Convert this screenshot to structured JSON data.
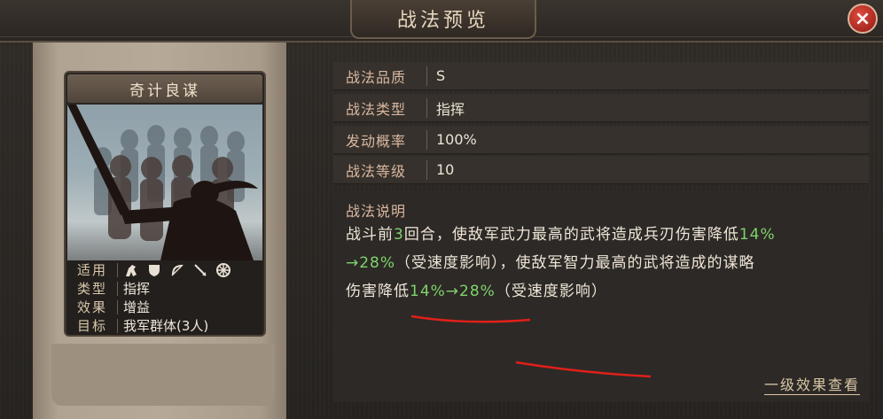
{
  "window": {
    "title": "战法预览",
    "close_symbol": "×"
  },
  "card": {
    "name": "奇计良谋",
    "rows": [
      {
        "key": "适用",
        "icons": [
          "cavalry-icon",
          "shield-icon",
          "bow-icon",
          "spear-icon",
          "wheel-icon"
        ]
      },
      {
        "key": "类型",
        "value": "指挥"
      },
      {
        "key": "效果",
        "value": "增益"
      },
      {
        "key": "目标",
        "value": "我军群体(3人)"
      }
    ]
  },
  "attributes": [
    {
      "key": "战法品质",
      "value": "S"
    },
    {
      "key": "战法类型",
      "value": "指挥"
    },
    {
      "key": "发动概率",
      "value": "100%"
    },
    {
      "key": "战法等级",
      "value": "10"
    }
  ],
  "description": {
    "title": "战法说明",
    "p1": "战斗前",
    "rounds": "3",
    "p2": "回合，使敌军武力最高的武将造成兵刃伤害降低",
    "v1a": "14%",
    "line2_v1b": "→28%",
    "speed1": "（受速度影响）",
    "p3": "，使敌军智力最高的武将造成的谋略",
    "p4": "伤害降低",
    "v2": "14%→28%",
    "speed2": "（受速度影响）"
  },
  "footer_link": "一级效果查看",
  "colors": {
    "highlight_green": "#7ed36c",
    "label_tan": "#d9b8a0",
    "annotation_red": "#e0201a"
  }
}
